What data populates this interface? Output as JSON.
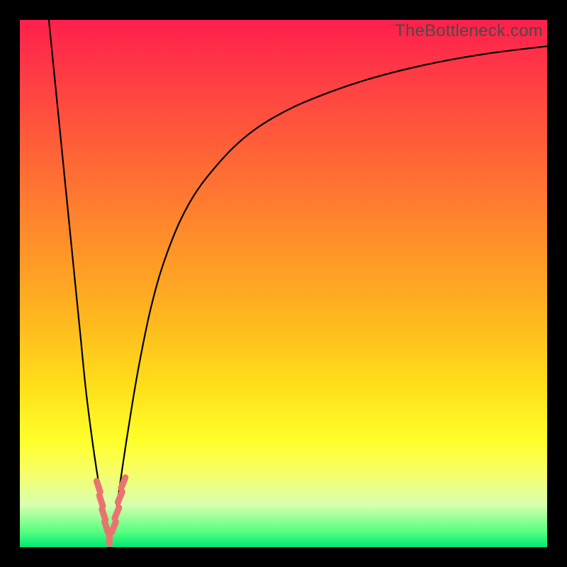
{
  "watermark": "TheBottleneck.com",
  "colors": {
    "background": "#000000",
    "curve": "#000000",
    "marker": "#e9746f"
  },
  "chart_data": {
    "type": "line",
    "title": "",
    "xlabel": "",
    "ylabel": "",
    "xlim": [
      0,
      100
    ],
    "ylim": [
      0,
      100
    ],
    "grid": false,
    "legend": false,
    "series": [
      {
        "name": "left-branch",
        "x": [
          5.5,
          6.5,
          7.5,
          8.5,
          9.5,
          10.5,
          11.5,
          12.5,
          13.5,
          14.5,
          15.5,
          16.2,
          16.8
        ],
        "y": [
          100,
          90,
          80,
          70,
          60,
          50,
          40,
          30,
          22,
          15,
          9,
          4.5,
          1.5
        ]
      },
      {
        "name": "right-branch",
        "x": [
          17.2,
          18,
          19,
          20.5,
          22.5,
          25,
          28,
          32,
          37,
          43,
          50,
          58,
          67,
          77,
          88,
          100
        ],
        "y": [
          1.5,
          5,
          12,
          22,
          34,
          46,
          56,
          65,
          72,
          78,
          82.5,
          86,
          89,
          91.5,
          93.5,
          95
        ]
      }
    ],
    "markers": [
      {
        "name": "dashed-tick-cluster",
        "shape": "rounded-dash",
        "color": "#e9746f",
        "points": [
          {
            "x": 14.9,
            "y": 11.5
          },
          {
            "x": 15.4,
            "y": 8.8
          },
          {
            "x": 15.9,
            "y": 6.2
          },
          {
            "x": 16.4,
            "y": 3.8
          },
          {
            "x": 17.0,
            "y": 1.7
          },
          {
            "x": 17.8,
            "y": 3.8
          },
          {
            "x": 18.4,
            "y": 6.5
          },
          {
            "x": 19.0,
            "y": 9.5
          },
          {
            "x": 19.6,
            "y": 12.2
          }
        ]
      }
    ]
  }
}
